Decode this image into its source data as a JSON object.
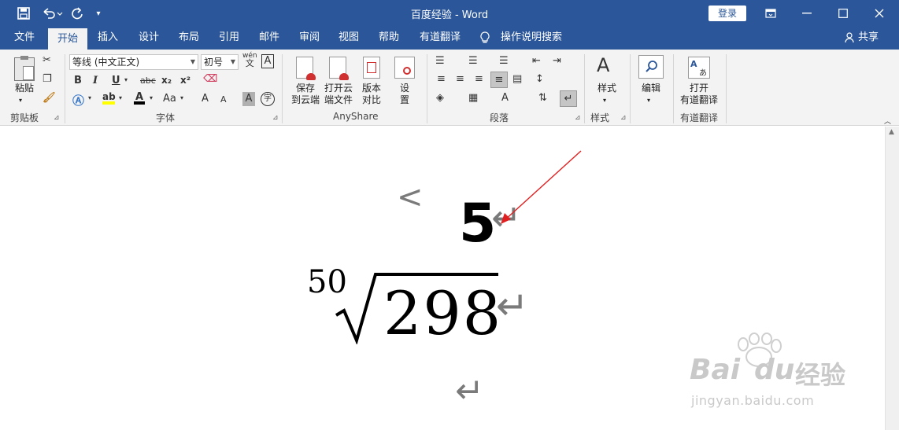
{
  "window": {
    "title": "百度经验  -  Word",
    "login_label": "登录"
  },
  "quick_access": [
    "save-icon",
    "undo-icon",
    "redo-icon",
    "customize-icon"
  ],
  "tabs": [
    {
      "label": "文件"
    },
    {
      "label": "开始"
    },
    {
      "label": "插入"
    },
    {
      "label": "设计"
    },
    {
      "label": "布局"
    },
    {
      "label": "引用"
    },
    {
      "label": "邮件"
    },
    {
      "label": "审阅"
    },
    {
      "label": "视图"
    },
    {
      "label": "帮助"
    },
    {
      "label": "有道翻译"
    },
    {
      "label": "操作说明搜索"
    }
  ],
  "share_label": "共享",
  "ribbon": {
    "clipboard": {
      "paste_label": "粘贴",
      "group_label": "剪贴板"
    },
    "font": {
      "font_name": "等线 (中文正文)",
      "font_size": "初号",
      "phonetic_top": "wén",
      "phonetic_bottom": "文",
      "bold": "B",
      "italic": "I",
      "underline": "U",
      "strike": "abc",
      "subscript": "x₂",
      "superscript": "x²",
      "grow": "A",
      "shrink": "A",
      "case": "Aa",
      "char_shade": "A",
      "enclose": "字",
      "group_label": "字体"
    },
    "anyshare": {
      "save_cloud": "保存\n到云端",
      "open_cloud": "打开云\n端文件",
      "compare": "版本\n对比",
      "settings": "设\n置",
      "group_label": "AnyShare"
    },
    "paragraph": {
      "group_label": "段落"
    },
    "styles": {
      "label": "样式",
      "group_label": "样式"
    },
    "editing": {
      "label": "编辑"
    },
    "youdao": {
      "label": "打开\n有道翻译",
      "group_label": "有道翻译"
    }
  },
  "document": {
    "big_number": "5",
    "radical_index": "50",
    "radicand": "298",
    "paragraph_mark": "↵",
    "arrow_mark": "<"
  },
  "watermark": {
    "brand": "Bai",
    "brand2": "du",
    "cn": "经验",
    "url": "jingyan.baidu.com"
  },
  "colors": {
    "title_bar": "#2b579a",
    "ribbon_bg": "#f3f3f3",
    "annotation_arrow": "#e02020"
  }
}
